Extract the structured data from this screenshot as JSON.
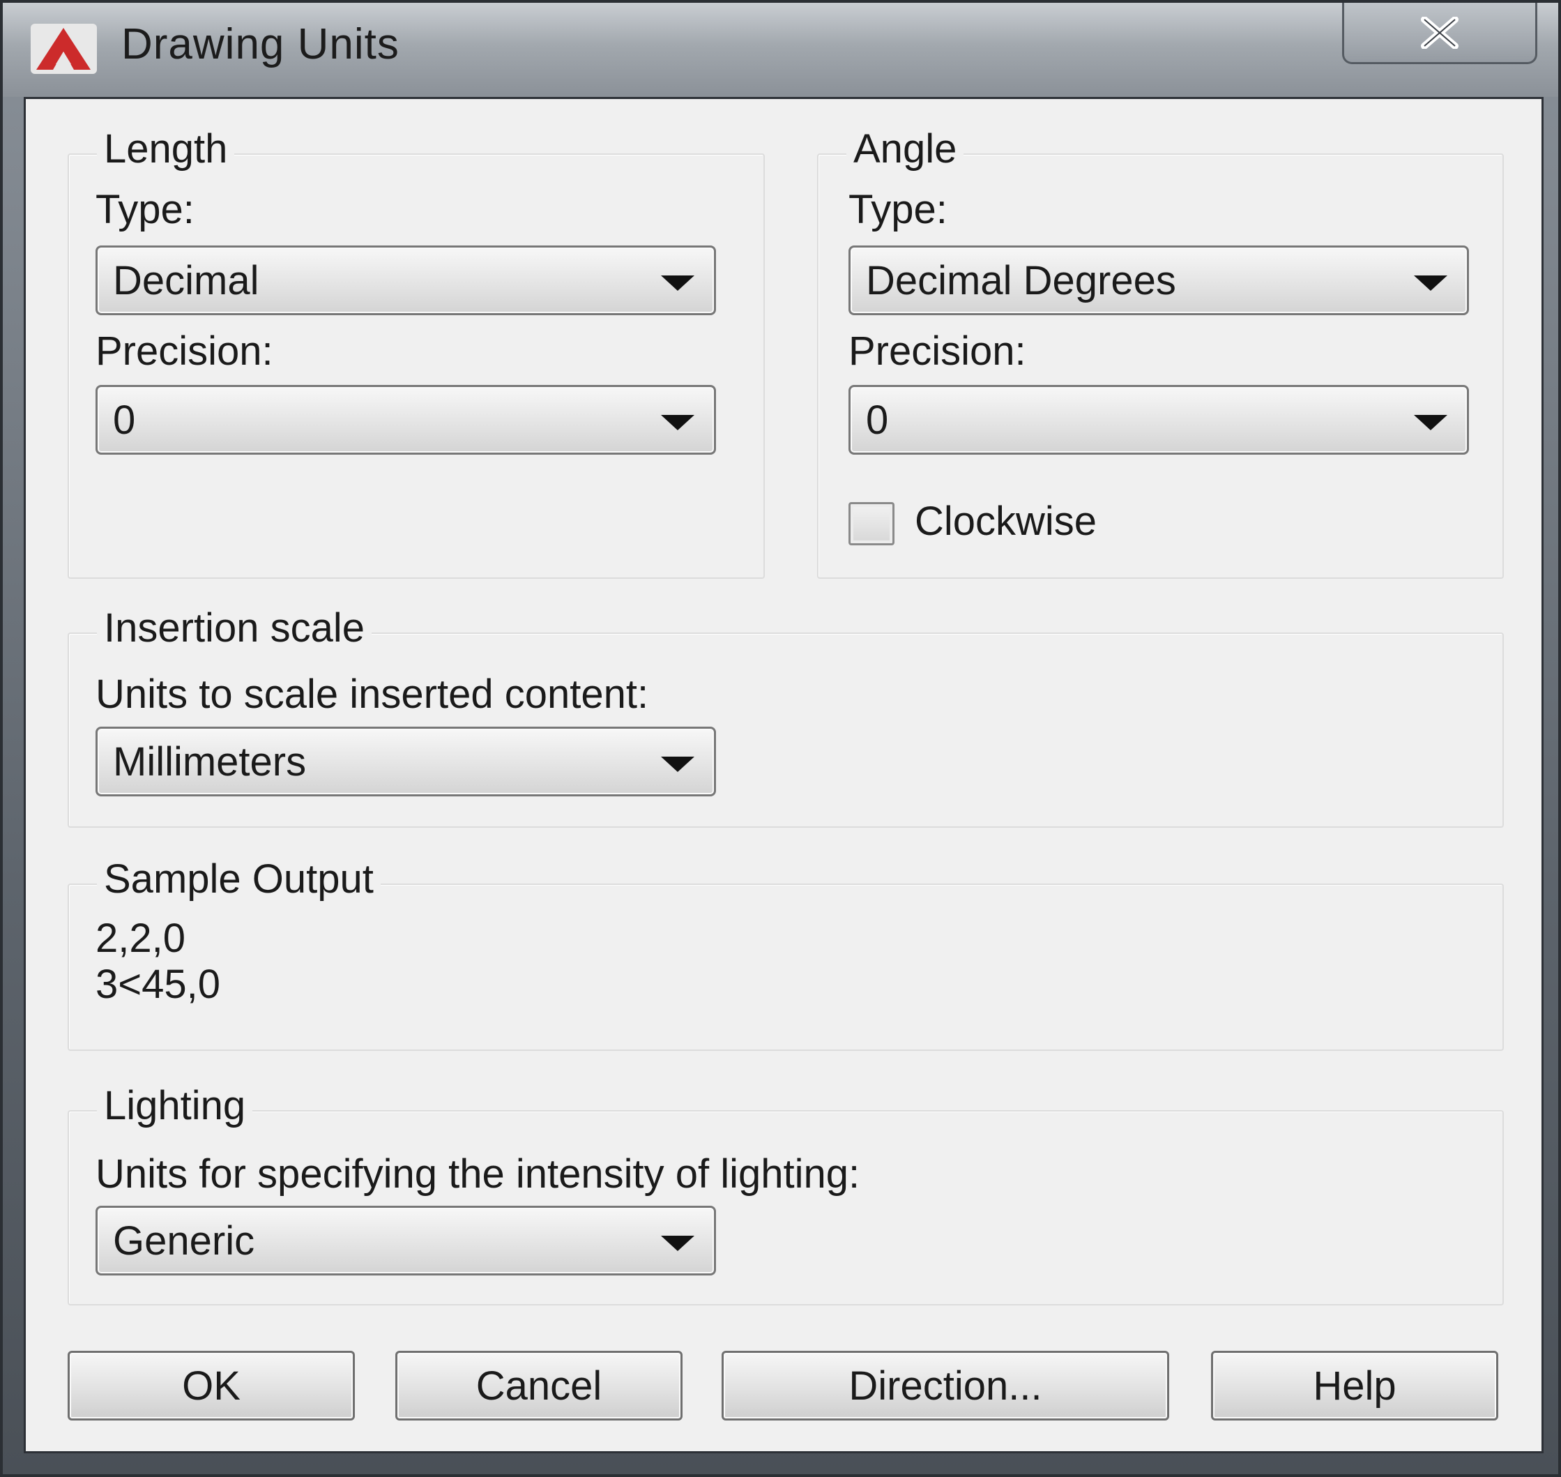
{
  "window": {
    "title": "Drawing Units"
  },
  "colors": {
    "app_icon": "#cc2b2b",
    "dialog_bg": "#f0f0f0",
    "titlebar": "#a2a8ae"
  },
  "icons": {
    "app": "autocad-logo-icon",
    "close": "close-icon",
    "dropdown": "chevron-down-icon"
  },
  "length": {
    "title": "Length",
    "type_label": "Type:",
    "type_value": "Decimal",
    "precision_label": "Precision:",
    "precision_value": "0"
  },
  "angle": {
    "title": "Angle",
    "type_label": "Type:",
    "type_value": "Decimal Degrees",
    "precision_label": "Precision:",
    "precision_value": "0",
    "clockwise_label": "Clockwise",
    "clockwise_checked": false
  },
  "insertion": {
    "title": "Insertion scale",
    "label": "Units to scale inserted content:",
    "value": "Millimeters"
  },
  "sample": {
    "title": "Sample Output",
    "line1": "2,2,0",
    "line2": "3<45,0"
  },
  "lighting": {
    "title": "Lighting",
    "label": "Units for specifying the intensity of lighting:",
    "value": "Generic"
  },
  "buttons": {
    "ok": "OK",
    "cancel": "Cancel",
    "direction": "Direction...",
    "help": "Help"
  }
}
